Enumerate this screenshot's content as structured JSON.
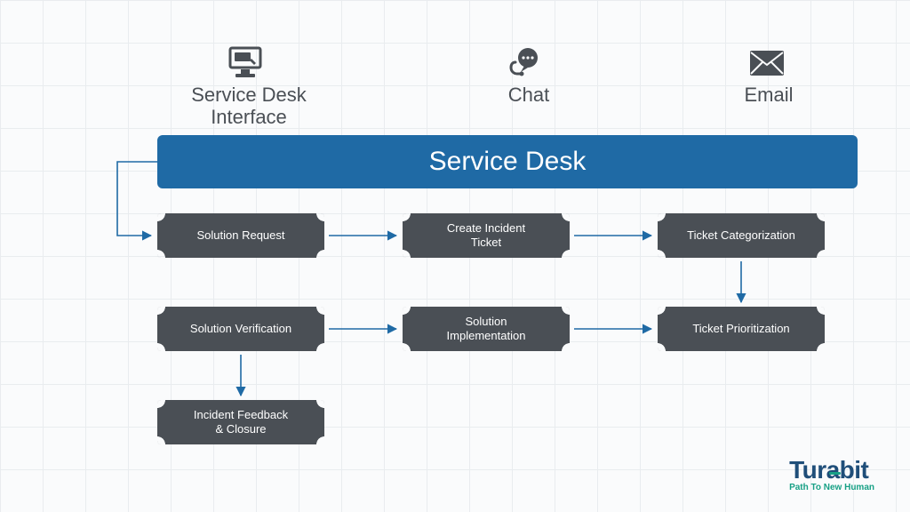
{
  "channels": [
    {
      "id": "service-desk-interface",
      "label": "Service Desk\nInterface",
      "icon": "computer-icon"
    },
    {
      "id": "chat",
      "label": "Chat",
      "icon": "headset-chat-icon"
    },
    {
      "id": "email",
      "label": "Email",
      "icon": "envelope-icon"
    }
  ],
  "hero_label": "Service Desk",
  "steps": {
    "solution_request": "Solution Request",
    "create_incident_ticket": "Create Incident\nTicket",
    "ticket_categorization": "Ticket Categorization",
    "solution_verification": "Solution Verification",
    "solution_implementation": "Solution\nImplementation",
    "ticket_prioritization": "Ticket Prioritization",
    "incident_feedback_closure": "Incident Feedback\n& Closure"
  },
  "brand": {
    "name": "Turabit",
    "tagline": "Path To New Human"
  },
  "colors": {
    "hero": "#1f6aa5",
    "ticket": "#4a4f55",
    "arrow": "#1f6aa5",
    "icon": "#4a4f55",
    "brand_blue": "#1f4e79",
    "brand_green": "#17a085"
  },
  "diagram_flow": [
    [
      "hero",
      "solution_request"
    ],
    [
      "solution_request",
      "create_incident_ticket"
    ],
    [
      "create_incident_ticket",
      "ticket_categorization"
    ],
    [
      "ticket_categorization",
      "ticket_prioritization"
    ],
    [
      "ticket_prioritization",
      "solution_implementation"
    ],
    [
      "solution_implementation",
      "solution_verification"
    ],
    [
      "solution_verification",
      "incident_feedback_closure"
    ]
  ]
}
